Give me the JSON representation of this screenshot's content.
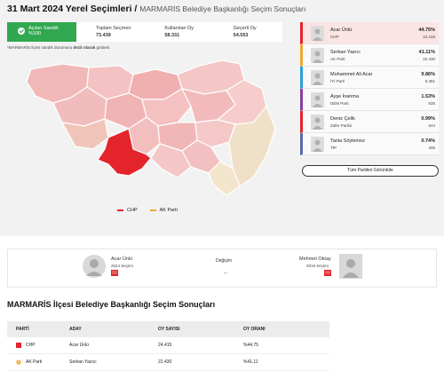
{
  "header": {
    "title_bold": "31 Mart 2024 Yerel Seçimleri /",
    "title_sub": "MARMARİS Belediye Başkanlığı Seçim Sonuçları"
  },
  "stats": {
    "opened_label": "Açılan Sandık",
    "opened_value": "%100",
    "total_label": "Toplam Seçmen",
    "total_value": "73.439",
    "used_label": "Kullanılan Oy",
    "used_value": "58.331",
    "valid_label": "Geçerli Oy",
    "valid_value": "54.553"
  },
  "note": {
    "prefix": "*MARMARİS ilçesi sandık durumunu",
    "bold": "dezit olarak",
    "suffix": "gösterir."
  },
  "legend": [
    {
      "label": "CHP",
      "color": "#e3242b"
    },
    {
      "label": "AK Parti",
      "color": "#f0a830"
    }
  ],
  "candidates": [
    {
      "name": "Acar Ünlü",
      "party": "CHP",
      "pct": "44.75%",
      "votes": "24.415",
      "color": "#e3242b",
      "win": true
    },
    {
      "name": "Serkan Yazıcı",
      "party": "AK Parti",
      "pct": "41.11%",
      "votes": "22.430",
      "color": "#f0a830",
      "win": false
    },
    {
      "name": "Muhammet Ali Acar",
      "party": "İYİ Parti",
      "pct": "9.86%",
      "votes": "5.381",
      "color": "#2a9fd8",
      "win": false
    },
    {
      "name": "Ayşe İnanma",
      "party": "DEM Parti",
      "pct": "1.53%",
      "votes": "835",
      "color": "#8a3fa0",
      "win": false
    },
    {
      "name": "Deniz Çelik",
      "party": "Zafer Partisi",
      "pct": "0.99%",
      "votes": "544",
      "color": "#e3242b",
      "win": false
    },
    {
      "name": "Tania Söylemez",
      "party": "TİP",
      "pct": "0.74%",
      "votes": "405",
      "color": "#5a6aa8",
      "win": false
    }
  ],
  "all_parties_button": "Tüm Partileri Görüntüle",
  "comparison": {
    "left_name": "Acar Ünlü",
    "left_year": "2024 Seçimi",
    "change_label": "Değişim",
    "right_name": "Mehmet Oktay",
    "right_year": "2019 Seçimi"
  },
  "results_title": "MARMARİS İlçesi Belediye Başkanlığı Seçim Sonuçları",
  "results_table": {
    "headers": [
      "PARTİ",
      "ADAY",
      "OY SAYISI",
      "OY ORANI"
    ],
    "rows": [
      {
        "party": "CHP",
        "candidate": "Acar Ünlü",
        "votes": "24.415",
        "rate": "%44.75"
      },
      {
        "party": "AK Parti",
        "candidate": "Serkan Yazıcı",
        "votes": "22.430",
        "rate": "%41.11"
      }
    ]
  }
}
